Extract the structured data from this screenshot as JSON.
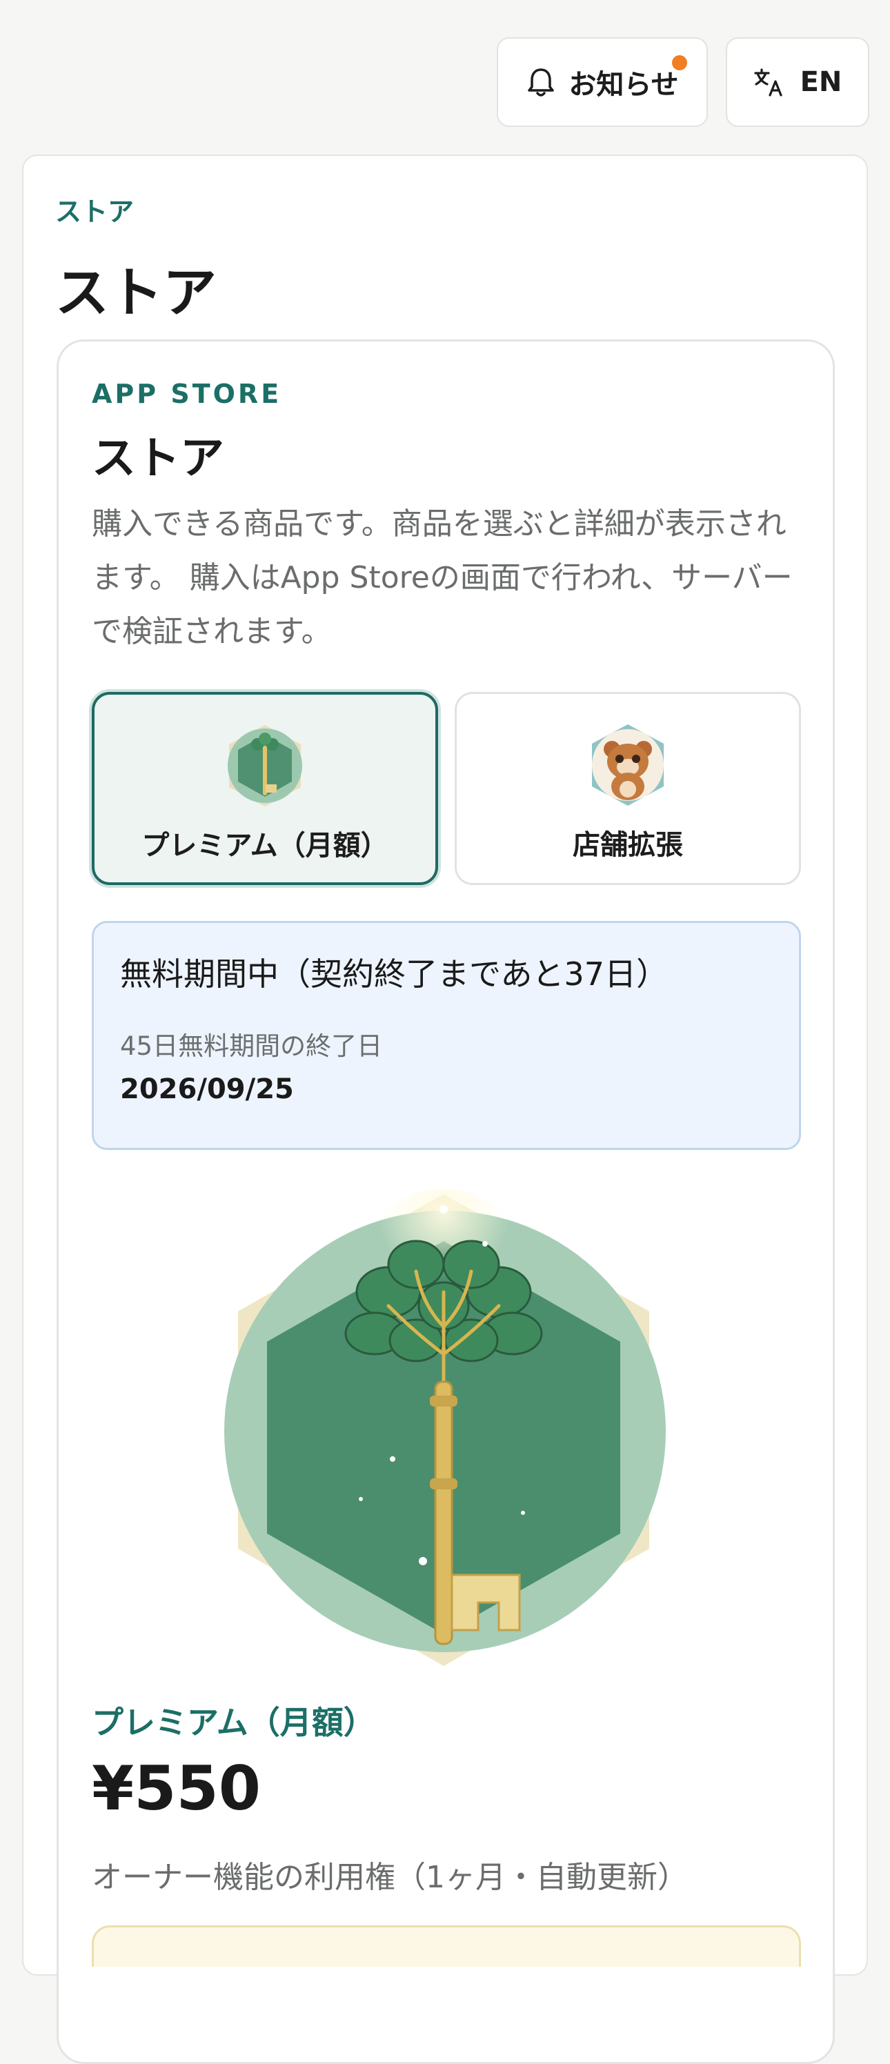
{
  "header": {
    "notice_label": "お知らせ",
    "notice_has_unread": true,
    "lang_label": "EN"
  },
  "breadcrumb": "ストア",
  "page_title": "ストア",
  "panel": {
    "eyebrow": "APP STORE",
    "title": "ストア",
    "description": "購入できる商品です。商品を選ぶと詳細が表示されます。 購入はApp Storeの画面で行われ、サーバーで検証されます。"
  },
  "products": [
    {
      "label": "プレミアム（月額）",
      "icon": "key-leaf-icon",
      "selected": true
    },
    {
      "label": "店舗拡張",
      "icon": "tanuki-icon",
      "selected": false
    }
  ],
  "trial": {
    "heading": "無料期間中（契約終了まであと37日）",
    "sub_label": "45日無料期間の終了日",
    "end_date": "2026/09/25"
  },
  "detail": {
    "name": "プレミアム（月額）",
    "price": "¥550",
    "description": "オーナー機能の利用権（1ヶ月・自動更新）"
  },
  "colors": {
    "accent": "#1b6f66",
    "notice_dot": "#f07e22",
    "trial_bg": "#eef4fd"
  }
}
